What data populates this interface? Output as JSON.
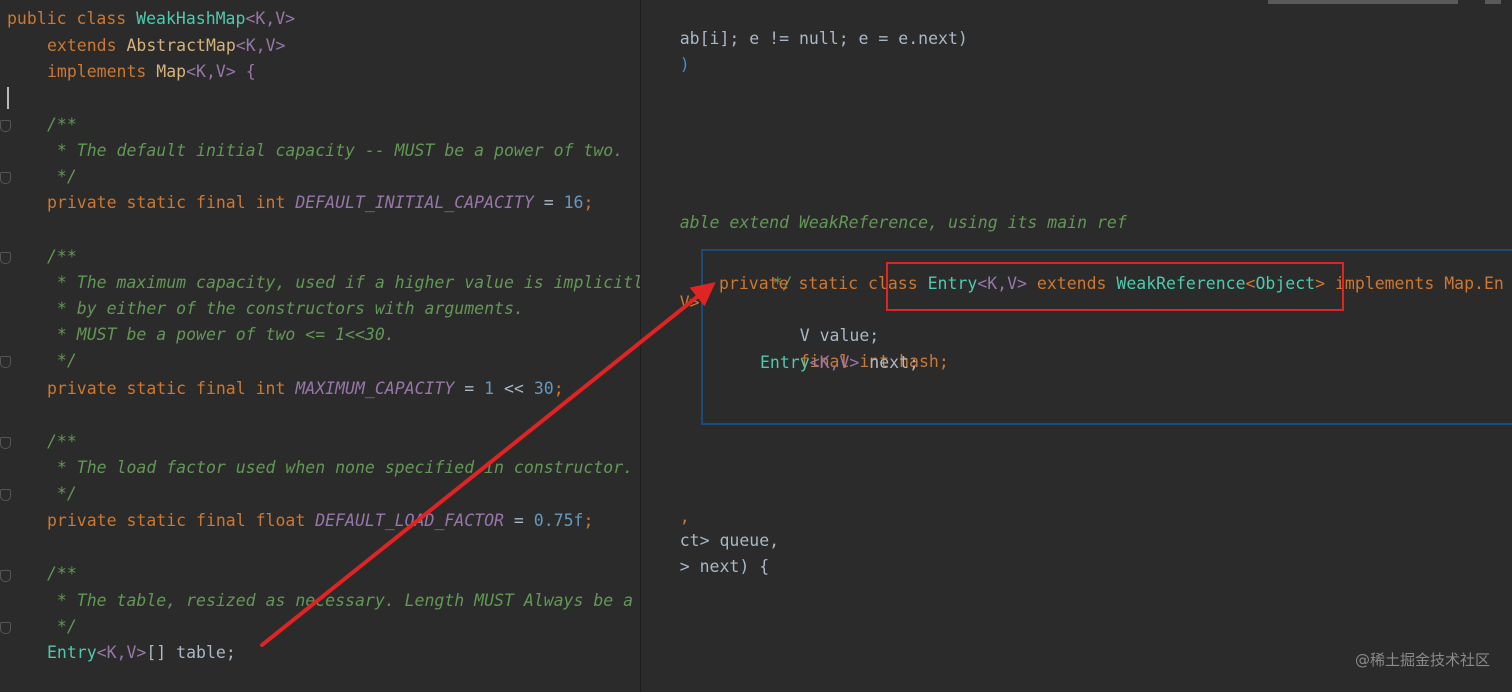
{
  "right_editor": {
    "line_loop": "ab[i]; e != null; e = e.next)",
    "line_paren": ")",
    "line_comment": "able extend WeakReference, using its main ref",
    "line_ext": "V> ext",
    "line_comma": ",",
    "line_queue": "ct> queue,",
    "line_next": "> next) {"
  },
  "popup": {
    "line_close_comment": "*/",
    "line_private": "private static class",
    "line_entry": "Entry",
    "line_kv": "<K,V>",
    "line_extends": "extends",
    "line_weakref": "WeakReference",
    "line_object": "Object",
    "line_implements": "implements Map.En",
    "line_value": "V value;",
    "line_hash": "final int hash;",
    "line_next_entry": "Entry",
    "line_next_rest": " next;",
    "line_open_comment": "/**"
  },
  "left_editor": {
    "l1_public": "public class",
    "l1_name": "WeakHashMap",
    "l1_tp": "<K,V>",
    "l2_extends": "extends",
    "l2_name": "AbstractMap",
    "l2_tp": "<K,V>",
    "l3_impl": "implements",
    "l3_name": "Map",
    "l3_tp": "<K,V> {",
    "c1_open": "/**",
    "c1_text": " * The default initial capacity -- MUST be a power of two.",
    "c1_close": " */",
    "f1_decl": "private static final int",
    "f1_name": "DEFAULT_INITIAL_CAPACITY",
    "f1_eq": " = ",
    "f1_val": "16",
    "f1_end": ";",
    "c2_open": "/**",
    "c2_text1": " * The maximum capacity, used if a higher value is implicitly specified",
    "c2_text2": " * by either of the constructors with arguments.",
    "c2_text3": " * MUST be a power of two <= 1<<30.",
    "c2_close": " */",
    "f2_decl": "private static final int",
    "f2_name": "MAXIMUM_CAPACITY",
    "f2_eq": " = ",
    "f2_val1": "1",
    "f2_op": " << ",
    "f2_val2": "30",
    "f2_end": ";",
    "c3_open": "/**",
    "c3_text": " * The load factor used when none specified in constructor.",
    "c3_close": " */",
    "f3_decl": "private static final float",
    "f3_name": "DEFAULT_LOAD_FACTOR",
    "f3_eq": " = ",
    "f3_val": "0.75f",
    "f3_end": ";",
    "c4_open": "/**",
    "c4_text": " * The table, resized as necessary. Length MUST Always be a power of two.",
    "c4_close": " */",
    "f4_type": "Entry",
    "f4_tp": "<K,V>",
    "f4_rest": "[] table;"
  },
  "watermark": "@稀土掘金技术社区",
  "colors": {
    "background": "#2b2b2b",
    "keyword": "#cc7832",
    "comment": "#629755",
    "constant": "#9876aa",
    "number": "#6897bb",
    "type_highlight": "#4ec9b0",
    "arrow": "#e02424",
    "popup_border": "#1c4b7a"
  }
}
